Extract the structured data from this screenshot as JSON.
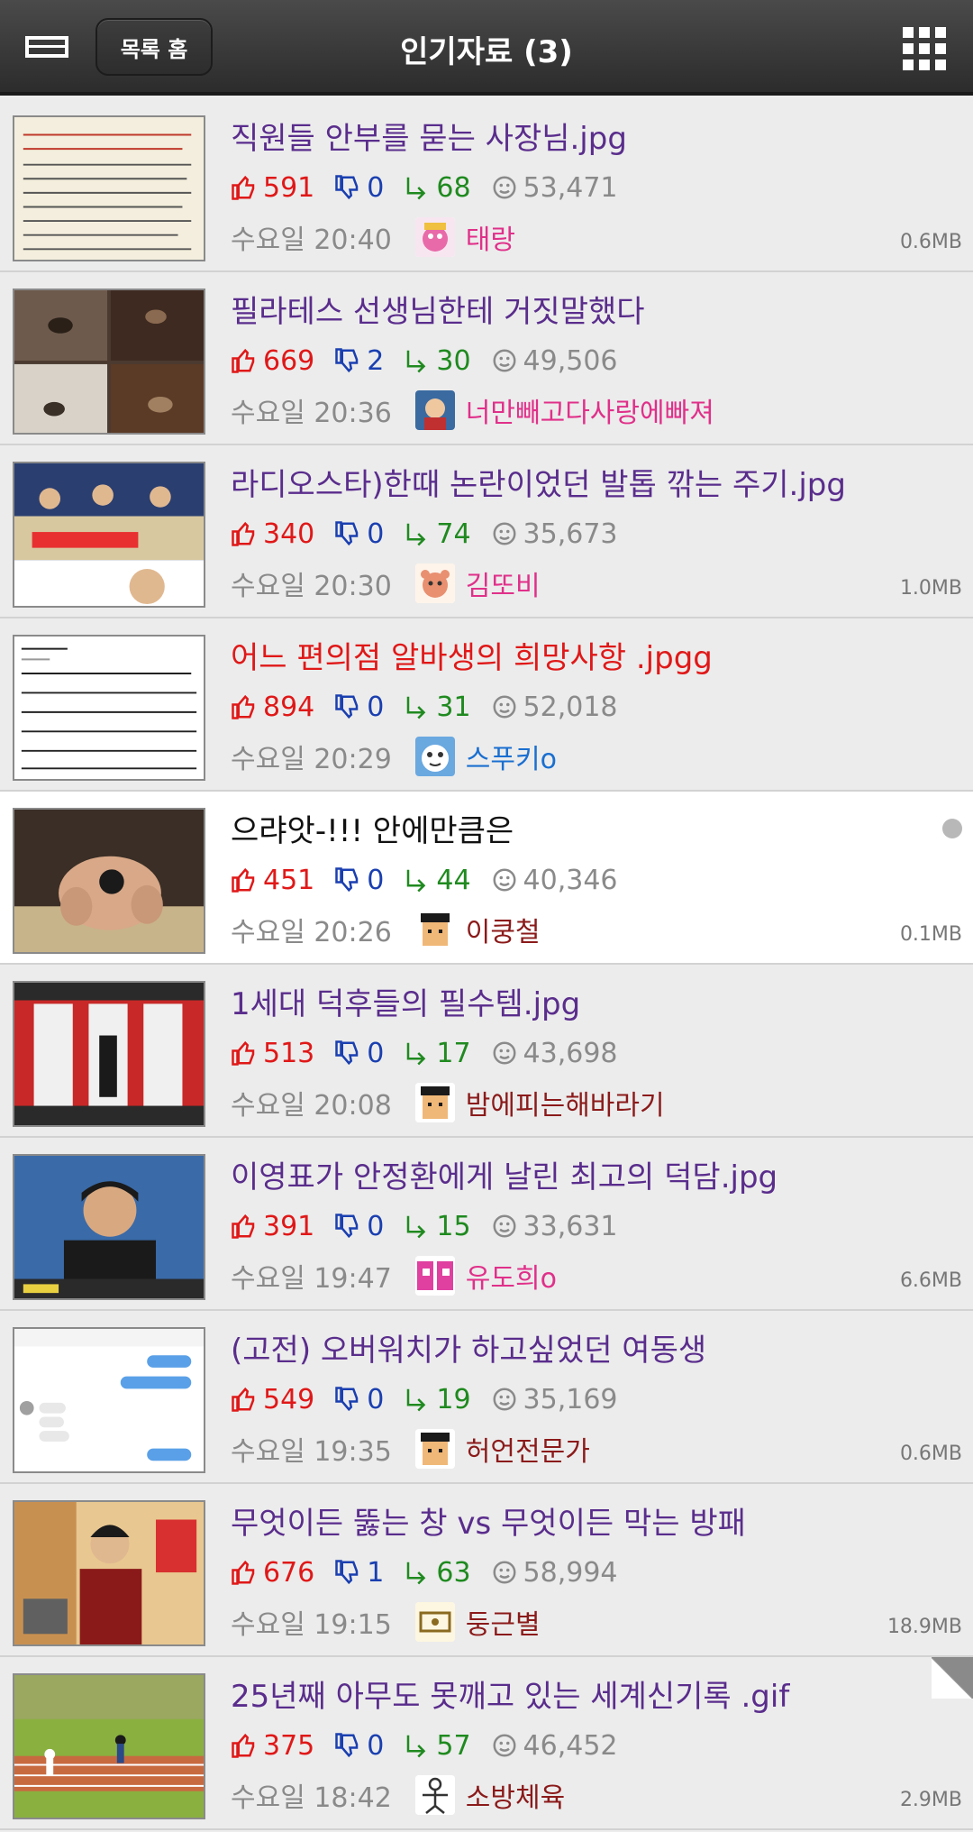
{
  "header": {
    "home_label": "목록 홈",
    "title": "인기자료 (3)",
    "menu_icon": "list-menu-icon",
    "grid_icon": "grid-menu-icon"
  },
  "colors": {
    "header_bg": "#2c2c2c",
    "title_default": "#5a2d8c",
    "title_hot": "#e01818",
    "likes": "#e01818",
    "dislikes": "#1a3fb0",
    "comments": "#1f8a1f",
    "views": "#8a8a8a",
    "active_row_bg": "#ffffff"
  },
  "posts": [
    {
      "title": "직원들 안부를 묻는 사장님.jpg",
      "likes": "591",
      "dislikes": "0",
      "comments": "68",
      "views": "53,471",
      "date": "수요일 20:40",
      "author": "태랑",
      "filesize": "0.6MB"
    },
    {
      "title": "필라테스 선생님한테 거짓말했다",
      "likes": "669",
      "dislikes": "2",
      "comments": "30",
      "views": "49,506",
      "date": "수요일 20:36",
      "author": "너만빼고다사랑에빠져",
      "filesize": ""
    },
    {
      "title": "라디오스타)한때 논란이었던 발톱 깎는 주기.jpg",
      "likes": "340",
      "dislikes": "0",
      "comments": "74",
      "views": "35,673",
      "date": "수요일 20:30",
      "author": "김또비",
      "filesize": "1.0MB"
    },
    {
      "title": "어느 편의점 알바생의 희망사항 .jpgg",
      "likes": "894",
      "dislikes": "0",
      "comments": "31",
      "views": "52,018",
      "date": "수요일 20:29",
      "author": "스푸키o",
      "filesize": ""
    },
    {
      "title": "으랴앗-!!! 안에만큼은",
      "likes": "451",
      "dislikes": "0",
      "comments": "44",
      "views": "40,346",
      "date": "수요일 20:26",
      "author": "이쿵철",
      "filesize": "0.1MB"
    },
    {
      "title": "1세대 덕후들의 필수템.jpg",
      "likes": "513",
      "dislikes": "0",
      "comments": "17",
      "views": "43,698",
      "date": "수요일 20:08",
      "author": "밤에피는해바라기",
      "filesize": ""
    },
    {
      "title": "이영표가 안정환에게 날린 최고의 덕담.jpg",
      "likes": "391",
      "dislikes": "0",
      "comments": "15",
      "views": "33,631",
      "date": "수요일 19:47",
      "author": "유도희o",
      "filesize": "6.6MB"
    },
    {
      "title": "(고전) 오버워치가 하고싶었던 여동생",
      "likes": "549",
      "dislikes": "0",
      "comments": "19",
      "views": "35,169",
      "date": "수요일 19:35",
      "author": "허언전문가",
      "filesize": "0.6MB"
    },
    {
      "title": "무엇이든 뚫는 창 vs 무엇이든 막는 방패",
      "likes": "676",
      "dislikes": "1",
      "comments": "63",
      "views": "58,994",
      "date": "수요일 19:15",
      "author": "둥근별",
      "filesize": "18.9MB"
    },
    {
      "title": "25년째 아무도 못깨고 있는 세계신기록 .gif",
      "likes": "375",
      "dislikes": "0",
      "comments": "57",
      "views": "46,452",
      "date": "수요일 18:42",
      "author": "소방체육",
      "filesize": "2.9MB"
    }
  ]
}
